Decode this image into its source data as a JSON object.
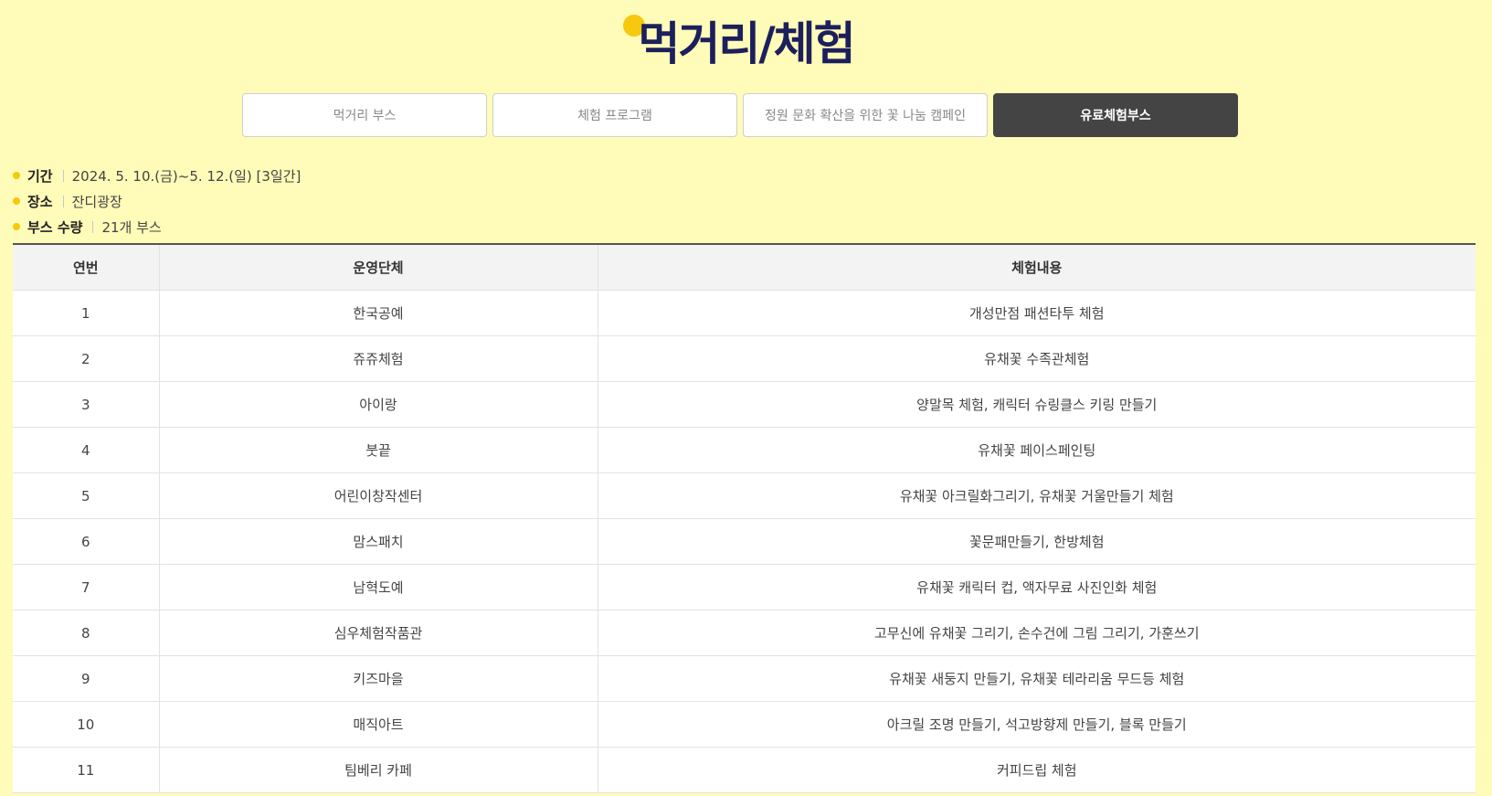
{
  "page": {
    "title": "먹거리/체험"
  },
  "tabs": [
    {
      "label": "먹거리 부스",
      "active": false
    },
    {
      "label": "체험 프로그램",
      "active": false
    },
    {
      "label": "정원 문화 확산을 위한 꽃 나눔 캠페인",
      "active": false
    },
    {
      "label": "유료체험부스",
      "active": true
    }
  ],
  "info": [
    {
      "label": "기간",
      "value": "2024. 5. 10.(금)~5. 12.(일) [3일간]"
    },
    {
      "label": "장소",
      "value": "잔디광장"
    },
    {
      "label": "부스 수량",
      "value": "21개 부스"
    }
  ],
  "table": {
    "headers": [
      "연번",
      "운영단체",
      "체험내용"
    ],
    "rows": [
      [
        "1",
        "한국공예",
        "개성만점 패션타투 체험"
      ],
      [
        "2",
        "쥬쥬체험",
        "유채꽃 수족관체험"
      ],
      [
        "3",
        "아이랑",
        "양말목 체험, 캐릭터 슈링클스 키링 만들기"
      ],
      [
        "4",
        "붓끝",
        "유채꽃 페이스페인팅"
      ],
      [
        "5",
        "어린이창작센터",
        "유채꽃 아크릴화그리기, 유채꽃 거울만들기 체험"
      ],
      [
        "6",
        "맘스패치",
        "꽃문패만들기, 한방체험"
      ],
      [
        "7",
        "남혁도예",
        "유채꽃 캐릭터 컵, 액자무료 사진인화 체험"
      ],
      [
        "8",
        "심우체험작품관",
        "고무신에 유채꽃 그리기, 손수건에 그림 그리기, 가훈쓰기"
      ],
      [
        "9",
        "키즈마을",
        "유채꽃 새둥지 만들기, 유채꽃 테라리움 무드등 체험"
      ],
      [
        "10",
        "매직아트",
        "아크릴 조명 만들기, 석고방향제 만들기, 블록 만들기"
      ],
      [
        "11",
        "팀베리 카페",
        "커피드립 체험"
      ]
    ]
  },
  "colors": {
    "background": "#fffbb8",
    "title": "#1c1f5c",
    "accent": "#f6c90e",
    "active_tab": "#444444"
  }
}
